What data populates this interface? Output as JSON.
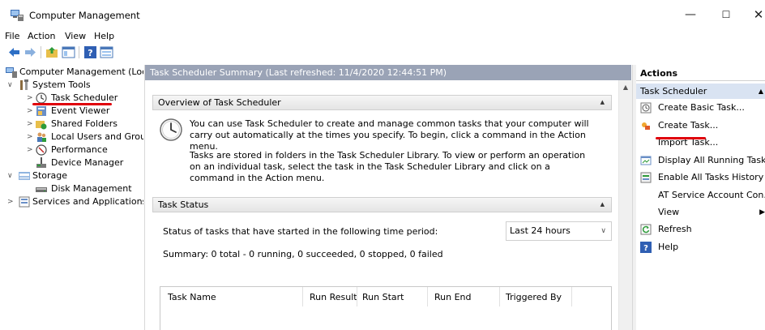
{
  "window": {
    "title": "Computer Management",
    "minimize_glyph": "—",
    "maximize_glyph": "☐",
    "close_glyph": "✕"
  },
  "menu": [
    "File",
    "Action",
    "View",
    "Help"
  ],
  "toolbar_icons": [
    "back-icon",
    "forward-icon",
    "up-folder-icon",
    "show-hide-tree-icon",
    "help-icon",
    "properties-icon"
  ],
  "tree": {
    "items": [
      {
        "label": "Computer Management (Local",
        "icon": "computer-management-icon",
        "chevron": ""
      },
      {
        "label": "System Tools",
        "icon": "tools-icon",
        "chevron": "∨"
      },
      {
        "label": "Task Scheduler",
        "icon": "clock-icon",
        "chevron": ">"
      },
      {
        "label": "Event Viewer",
        "icon": "event-viewer-icon",
        "chevron": ">"
      },
      {
        "label": "Shared Folders",
        "icon": "shared-folder-icon",
        "chevron": ">"
      },
      {
        "label": "Local Users and Groups",
        "icon": "users-icon",
        "chevron": ">"
      },
      {
        "label": "Performance",
        "icon": "performance-icon",
        "chevron": ">"
      },
      {
        "label": "Device Manager",
        "icon": "device-manager-icon",
        "chevron": ""
      },
      {
        "label": "Storage",
        "icon": "storage-icon",
        "chevron": "∨"
      },
      {
        "label": "Disk Management",
        "icon": "disk-icon",
        "chevron": ""
      },
      {
        "label": "Services and Applications",
        "icon": "services-icon",
        "chevron": ">"
      }
    ]
  },
  "center": {
    "header": "Task Scheduler Summary (Last refreshed: 11/4/2020 12:44:51 PM)",
    "overview_title": "Overview of Task Scheduler",
    "overview_p1": "You can use Task Scheduler to create and manage common tasks that your computer will carry out automatically at the times you specify. To begin, click a command in the Action menu.",
    "overview_p2": "Tasks are stored in folders in the Task Scheduler Library. To view or perform an operation on an individual task, select the task in the Task Scheduler Library and click on a command in the Action menu.",
    "status_title": "Task Status",
    "status_label": "Status of tasks that have started in the following time period:",
    "period_value": "Last 24 hours",
    "summary": "Summary: 0 total - 0 running, 0 succeeded, 0 stopped, 0 failed",
    "columns": [
      "Task Name",
      "Run Result",
      "Run Start",
      "Run End",
      "Triggered By"
    ]
  },
  "actions": {
    "title": "Actions",
    "group": "Task Scheduler",
    "items": [
      {
        "label": "Create Basic Task...",
        "icon": "create-basic-task-icon"
      },
      {
        "label": "Create Task...",
        "icon": "create-task-icon"
      },
      {
        "label": "Import Task...",
        "icon": ""
      },
      {
        "label": "Display All Running Tasks",
        "icon": "running-tasks-icon"
      },
      {
        "label": "Enable All Tasks History",
        "icon": "history-icon"
      },
      {
        "label": "AT Service Account Con...",
        "icon": ""
      },
      {
        "label": "View",
        "icon": "",
        "submenu": "▶"
      },
      {
        "label": "Refresh",
        "icon": "refresh-icon"
      },
      {
        "label": "Help",
        "icon": "help-icon"
      }
    ]
  },
  "colors": {
    "center_header_bg": "#9aa3b6",
    "actions_group_bg": "#d9e3f2",
    "annotation_red": "#e0000a"
  }
}
